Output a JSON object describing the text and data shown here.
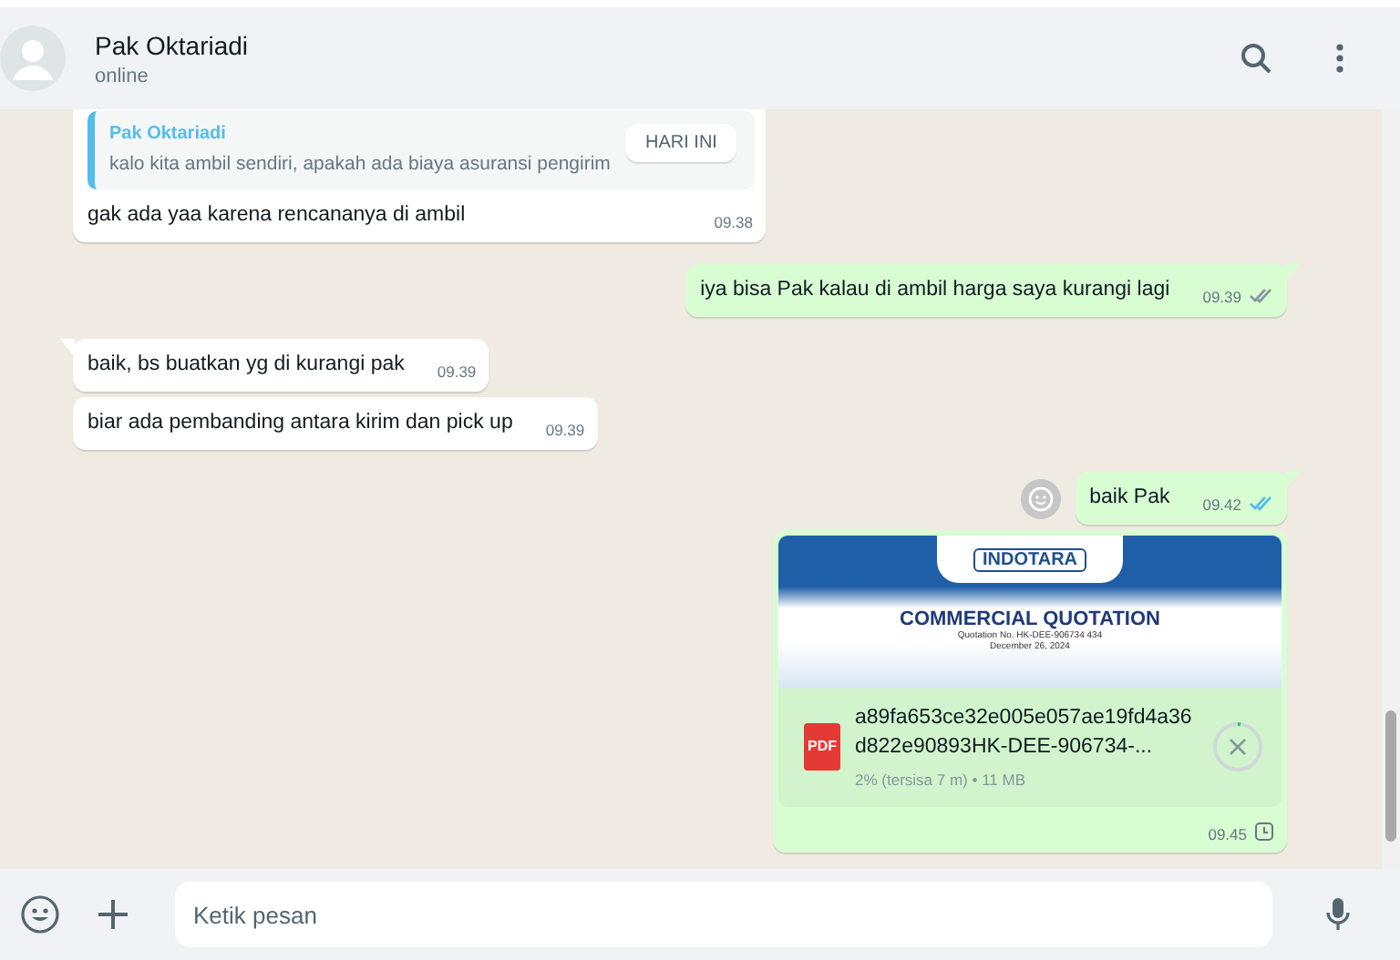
{
  "header": {
    "contact_name": "Pak Oktariadi",
    "status": "online"
  },
  "date_chip": "HARI INI",
  "messages": [
    {
      "kind": "text",
      "outgoing": false,
      "tail": false,
      "quote": {
        "author": "Pak Oktariadi",
        "text": "kalo kita ambil sendiri, apakah ada biaya asuransi pengirim"
      },
      "text": "gak ada yaa karena rencananya di ambil",
      "time": "09.38"
    },
    {
      "kind": "text",
      "outgoing": true,
      "tail": true,
      "text": "iya bisa Pak kalau di ambil harga saya kurangi lagi",
      "time": "09.39",
      "read": false
    },
    {
      "kind": "text",
      "outgoing": false,
      "tail": true,
      "text": "baik, bs buatkan yg di kurangi pak",
      "time": "09.39"
    },
    {
      "kind": "text",
      "outgoing": false,
      "tail": false,
      "text": "biar ada pembanding antara kirim dan pick up",
      "time": "09.39"
    },
    {
      "kind": "text",
      "outgoing": true,
      "tail": true,
      "react": true,
      "text": "baik Pak",
      "time": "09.42",
      "read": true
    },
    {
      "kind": "document",
      "outgoing": true,
      "tail": false,
      "preview": {
        "logo": "INDOTARA",
        "title": "COMMERCIAL QUOTATION",
        "line_1": "Quotation No. HK-DEE-906734 434",
        "line_2": "December 26, 2024"
      },
      "file_type": "PDF",
      "file_name": "a89fa653ce32e005e057ae19fd4a36d822e90893HK-DEE-906734-...",
      "progress_text": "2% (tersisa 7 m) • 11 MB",
      "level": 0.02,
      "time": "09.45",
      "pending": true
    }
  ],
  "composer": {
    "placeholder": "Ketik pesan"
  }
}
